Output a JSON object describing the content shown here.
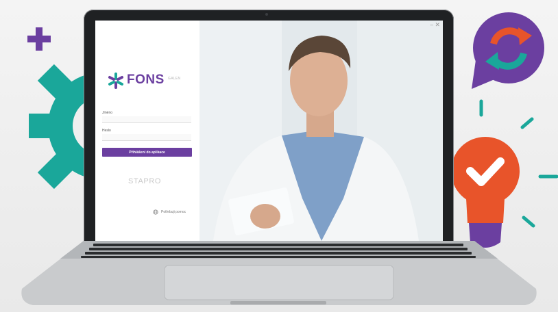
{
  "app": {
    "brand": "FONS",
    "brand_suffix": "GALEN",
    "vendor": "STAPRO"
  },
  "login": {
    "username_label": "Jméno",
    "username_value": "",
    "password_label": "Heslo",
    "password_value": "",
    "submit_label": "Přihlášení do aplikace"
  },
  "help": {
    "label": "Potřebuji pomoc"
  },
  "window": {
    "minimize_glyph": "–",
    "close_glyph": "✕"
  },
  "colors": {
    "brand_purple": "#6b3fa0",
    "teal": "#1aa79a",
    "orange": "#e8542a"
  },
  "icons": [
    "plus-icon",
    "gear-icon",
    "refresh-bubble-icon",
    "lightbulb-check-icon",
    "globe-icon",
    "fons-logo-mark"
  ]
}
